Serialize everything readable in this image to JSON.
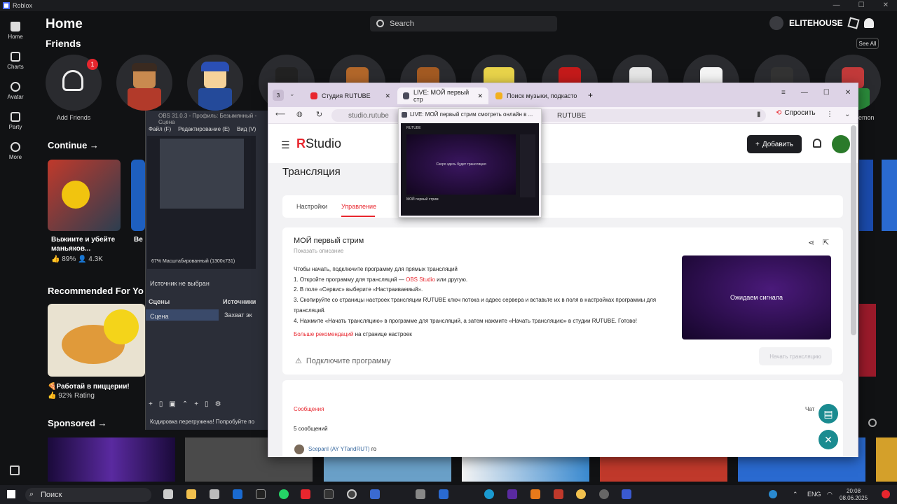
{
  "window": {
    "title": "Roblox"
  },
  "nav": [
    {
      "label": "Home"
    },
    {
      "label": "Charts"
    },
    {
      "label": "Avatar"
    },
    {
      "label": "Party"
    },
    {
      "label": "More"
    }
  ],
  "header": {
    "title": "Home",
    "search_placeholder": "Search",
    "username": "ELITEHOUSE"
  },
  "friends": {
    "title": "Friends",
    "see_all": "See All",
    "add_label": "Add Friends",
    "badge": "1",
    "partial_name": "emon"
  },
  "continue": {
    "title": "Continue →",
    "games": [
      {
        "title": "Выжиите и убейте маньяков...",
        "rating": "89%",
        "players": "4.3K"
      },
      {
        "title": "Ве",
        "rating": "",
        "players": ""
      }
    ]
  },
  "recommended": {
    "title": "Recommended For Yo",
    "games": [
      {
        "title": "🍕Работай в пиццерии!",
        "rating": "92% Rating"
      }
    ]
  },
  "sponsored": {
    "title": "Sponsored →"
  },
  "obs": {
    "title": "OBS 31.0.3 - Профиль: Безымянный - Сцена",
    "menu": [
      "Файл (F)",
      "Редактирование (E)",
      "Вид (V)"
    ],
    "no_source": "Источник не выбран",
    "scenes": "Сцены",
    "sources": "Источники",
    "scene_item": "Сцена",
    "source_item": "Захват эк",
    "overload": "Кодировка перегружена! Попробуйте по",
    "mini_scale": "67%   Масштабированный (1300x731)"
  },
  "browser": {
    "tab_count": "3",
    "tabs": [
      {
        "label": "Студия RUTUBE"
      },
      {
        "label": "LIVE: МОЙ первый стр"
      },
      {
        "label": "Поиск музыки, подкасто"
      }
    ],
    "url": "studio.rutube",
    "url_tail": "RUTUBE",
    "ask_label": "Спросить",
    "popup_title": "LIVE: МОЙ первый стрим смотреть онлайн в ...",
    "popup_logo": "RUTUBE",
    "popup_text": "Скоро здесь будет трансляция",
    "popup_stream": "МОЙ первый стрим"
  },
  "studio": {
    "logo_r": "R",
    "logo_text": "Studio",
    "add_button": "Добавить",
    "page_title": "Трансляция",
    "tabs": [
      "Настройки",
      "Управление"
    ],
    "stream_title": "МОЙ первый стрим",
    "show_desc": "Показать описание",
    "intro": "Чтобы начать, подключите программу для прямых трансляций",
    "steps": [
      "1. Откройте программу для трансляций — ",
      "2. В поле «Сервис» выберите «Настраиваемый».",
      "3. Скопируйте со страницы настроек трансляции RUTUBE ключ потока и адрес сервера и вставьте их в поля в настройках программы для трансляций.",
      "4. Нажмите «Начать трансляцию» в программе для трансляций, а затем нажмите «Начать трансляцию» в студии RUTUBE. Готово!"
    ],
    "obs_link": "OBS Studio",
    "obs_tail": " или другую.",
    "more_recs": "Больше рекомендаций",
    "more_recs_tail": " на странице настроек",
    "connect": "Подключите программу",
    "waiting": "Ожидаем сигнала",
    "start_btn": "Начать трансляцию",
    "messages_tab": "Сообщения",
    "chat_tab": "Чат",
    "msg_count": "5 сообщений",
    "msg_author": "Scepanl (AY YTandRUT)",
    "msg_text": "го"
  },
  "taskbar": {
    "search": "Поиск",
    "lang": "ENG",
    "time": "20:08",
    "date": "08.06.2025"
  },
  "colors": {
    "accent_red": "#e8262e",
    "roblox_bg": "#111214",
    "browser_tabbar": "#ddd3e6",
    "teal": "#1a8b90"
  }
}
